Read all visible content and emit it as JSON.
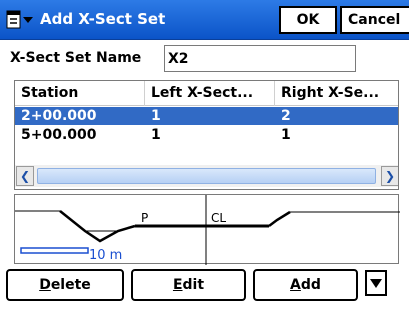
{
  "window": {
    "title": "Add X-Sect Set",
    "ok_label": "OK",
    "cancel_label": "Cancel"
  },
  "form": {
    "name_label": "X-Sect Set Name",
    "name_value": "X2"
  },
  "table": {
    "columns": [
      "Station",
      "Left X-Sect...",
      "Right X-Se..."
    ],
    "rows": [
      {
        "station": "2+00.000",
        "left": "1",
        "right": "2",
        "selected": true
      },
      {
        "station": "5+00.000",
        "left": "1",
        "right": "1",
        "selected": false
      }
    ]
  },
  "profile": {
    "label_p": "P",
    "label_cl": "CL",
    "scale_label": "10 m"
  },
  "buttons": {
    "delete": "Delete",
    "edit": "Edit",
    "add": "Add"
  },
  "colors": {
    "titlebar": "#0b54c8",
    "selection": "#316ac5",
    "scale_bar": "#1a4fd0"
  }
}
